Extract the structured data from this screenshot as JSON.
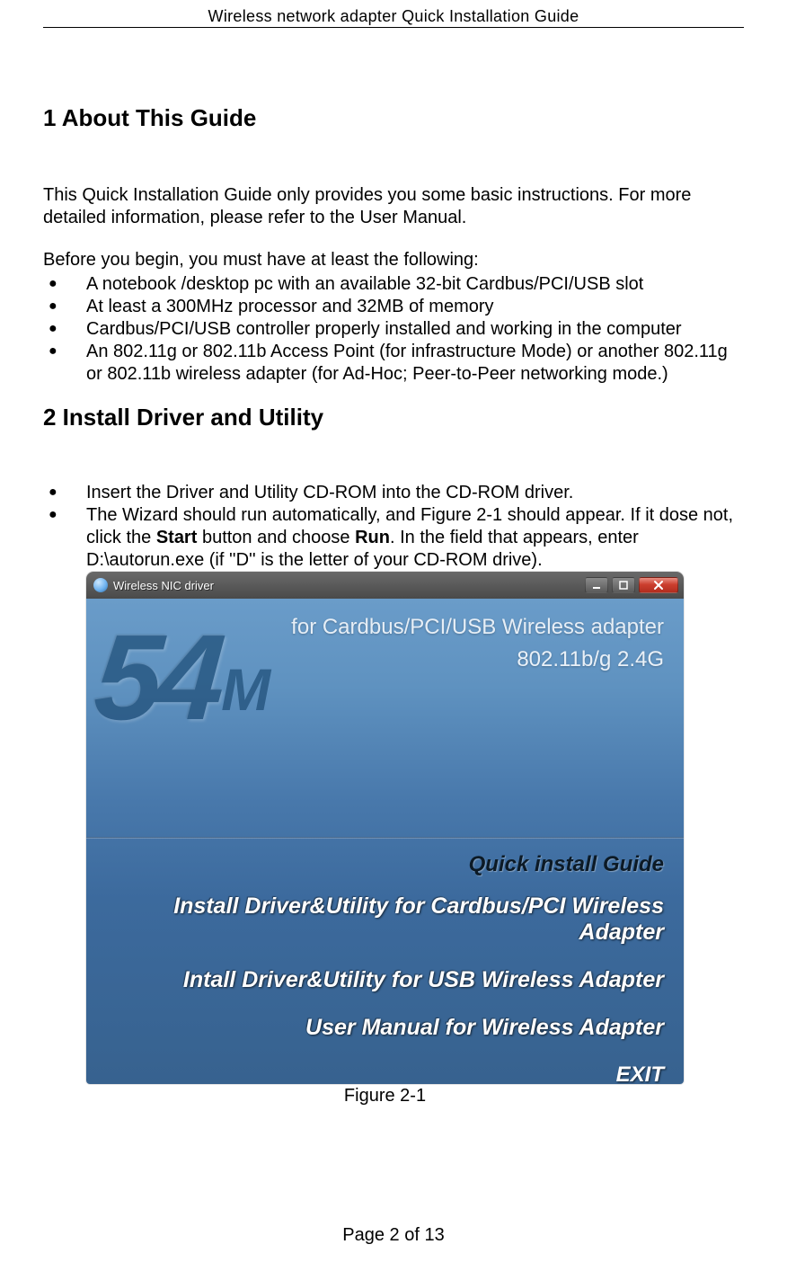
{
  "header": {
    "title": "Wireless network adapter Quick Installation Guide"
  },
  "sections": {
    "s1": {
      "heading": "1  About This Guide",
      "intro": "This Quick Installation Guide only provides you some basic instructions. For more detailed information, please refer to the User Manual.",
      "lead": "Before you begin, you must have at least the following:",
      "bullets": [
        "A notebook /desktop pc with an available 32-bit Cardbus/PCI/USB slot",
        "At least a 300MHz processor and 32MB of memory",
        "Cardbus/PCI/USB controller properly installed and working in the computer",
        "An 802.11g or 802.11b Access Point (for infrastructure Mode) or another 802.11g or 802.11b wireless adapter (for Ad-Hoc; Peer-to-Peer networking mode.)"
      ]
    },
    "s2": {
      "heading": "2  Install Driver and Utility",
      "bullets_a": "Insert the Driver and Utility CD-ROM into the CD-ROM driver.",
      "bullets_b_pre": "The Wizard should run automatically, and Figure 2-1 should appear. If it dose not, click the ",
      "bullets_b_start": "Start",
      "bullets_b_mid": " button and choose ",
      "bullets_b_run": "Run",
      "bullets_b_post": ". In the field that appears, enter D:\\autorun.exe (if ''D'' is the letter of your CD-ROM drive)."
    }
  },
  "autorun": {
    "window_title": "Wireless NIC driver",
    "top_line1": "for Cardbus/PCI/USB Wireless adapter",
    "top_line2": "802.11b/g  2.4G",
    "logo_num": "54",
    "logo_unit": "M",
    "menu": {
      "guide": "Quick install Guide",
      "opt1": "Install Driver&Utility for Cardbus/PCI Wireless Adapter",
      "opt2": "Intall  Driver&Utility for USB Wireless Adapter",
      "opt3": "User Manual for Wireless Adapter",
      "exit": "EXIT"
    }
  },
  "figure_caption": "Figure 2-1",
  "footer": "Page 2 of 13"
}
